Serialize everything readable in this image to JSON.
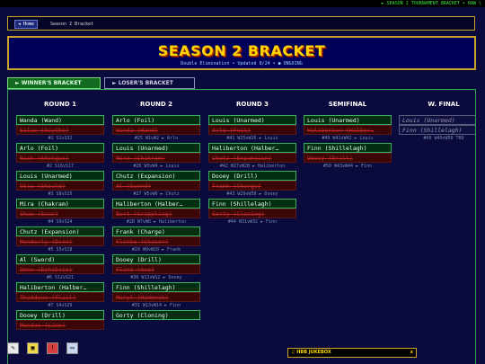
{
  "ticker": "► SEASON 2 TOURNAMENT BRACKET • RAW \\",
  "breadcrumb": {
    "home": "◄ Home",
    "current": "Season 2 Bracket"
  },
  "banner": {
    "title": "SEASON 2 BRACKET",
    "subtitle": "Double Elimination • Updated 8/24 • ● ONGOING"
  },
  "tabs": [
    {
      "label": "► WINNER'S BRACKET",
      "active": true
    },
    {
      "label": "► LOSER'S BRACKET",
      "active": false
    }
  ],
  "columns": [
    {
      "title": "ROUND 1",
      "matches": [
        {
          "winner": "Wanda (Wand)",
          "loser": "Silas (Scythe)",
          "meta": "#1 S1vS32"
        },
        {
          "winner": "Arlo (Foil)",
          "loser": "Rick (Shotgun)",
          "meta": "#2 S16vS17"
        },
        {
          "winner": "Louis (Unarmed)",
          "loser": "Otis (Shield)",
          "meta": "#3 S8vS25"
        },
        {
          "winner": "Mira (Chakram)",
          "loser": "Shaw (Scar)",
          "meta": "#4 S9vS24"
        },
        {
          "winner": "Chutz (Expansion)",
          "loser": "Menderly (Dice)",
          "meta": "#5 S5vS28"
        },
        {
          "winner": "Al (Sword)",
          "loser": "Omen (Exhibits)",
          "meta": "#6 S12vS21"
        },
        {
          "winner": "Haliberton (Halber…",
          "loser": "Thaddeus (Flail)",
          "meta": "#7 S4vS29"
        },
        {
          "winner": "Dooey (Drill)",
          "loser": "Mundus (Lime)",
          "meta": ""
        }
      ]
    },
    {
      "title": "ROUND 2",
      "matches": [
        {
          "winner": "Arlo (Foil)",
          "loser": "Wanda (Wand)",
          "meta": "#25 W1vW2 ► Arlo"
        },
        {
          "winner": "Louis (Unarmed)",
          "loser": "Mira (Chakram)",
          "meta": "#26 W3vW4 ► Louis"
        },
        {
          "winner": "Chutz (Expansion)",
          "loser": "Al (Sword)",
          "meta": "#27 W5vW6 ► Chutz"
        },
        {
          "winner": "Haliberton (Halber…",
          "loser": "Burt (Grappling)",
          "meta": "#28 W7vW8 ► Haliberton"
        },
        {
          "winner": "Frank (Charge)",
          "loser": "Flikke (Chaser)",
          "meta": "#29 W9vW10 ► Frank"
        },
        {
          "winner": "Dooey (Drill)",
          "loser": "Flint (Axe)",
          "meta": "#30 W11vW12 ► Dooey"
        },
        {
          "winner": "Finn (Shillelagh)",
          "loser": "Meryl (Hammock)",
          "meta": "#31 W13vW14 ► Finn"
        },
        {
          "winner": "Gorty (Cloning)",
          "loser": "",
          "meta": ""
        }
      ]
    },
    {
      "title": "ROUND 3",
      "matches": [
        {
          "winner": "Louis (Unarmed)",
          "loser": "Arlo (Foil)",
          "meta": "#41 W25vW26 ► Louis"
        },
        {
          "winner": "Haliberton (Halber…",
          "loser": "Chutz (Expansion)",
          "meta": "#42 W27vW28 ► Haliberton"
        },
        {
          "winner": "Dooey (Drill)",
          "loser": "Frank (Charge)",
          "meta": "#43 W29vW30 ► Dooey"
        },
        {
          "winner": "Finn (Shillelagh)",
          "loser": "Gorty (Cloning)",
          "meta": "#44 W31vW32 ► Finn"
        }
      ]
    },
    {
      "title": "SEMIFINAL",
      "matches": [
        {
          "winner": "Louis (Unarmed)",
          "loser": "Haliberton (Halber…",
          "meta": "#49 W41vW42 ► Louis"
        },
        {
          "winner": "Finn (Shillelagh)",
          "loser": "Dooey (Drill)",
          "meta": "#50 W43vW44 ► Finn"
        }
      ]
    },
    {
      "title": "W. FINAL",
      "matches": [
        {
          "a": "Louis (Unarmed)",
          "b": "Finn (Shillelagh)",
          "meta": "#60 W49vW50 TBD"
        }
      ]
    }
  ],
  "jukebox": {
    "label": "♫ HBB JUKEBOX",
    "close": "x"
  },
  "footer_icons": [
    {
      "name": "notepad-icon",
      "glyph": "✎"
    },
    {
      "name": "folder-icon",
      "glyph": "▣"
    },
    {
      "name": "warning-icon",
      "glyph": "!"
    },
    {
      "name": "monitor-icon",
      "glyph": "▭"
    }
  ]
}
